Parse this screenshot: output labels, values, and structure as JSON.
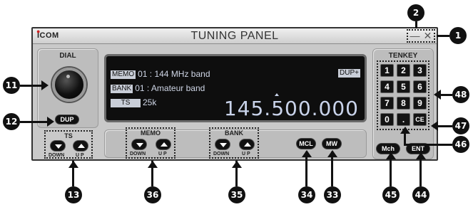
{
  "window": {
    "logo": "ICOM",
    "title": "TUNING PANEL",
    "minimize_glyph": "—",
    "close_glyph": "✕"
  },
  "dial": {
    "label": "DIAL",
    "dup_button": "DUP"
  },
  "ts_group": {
    "label": "TS",
    "down": "DOWN",
    "up": "U P"
  },
  "memo_group": {
    "label": "MEMO",
    "down": "DOWN",
    "up": "U P"
  },
  "bank_group": {
    "label": "BANK",
    "down": "DOWN",
    "up": "U P"
  },
  "buttons": {
    "mcl": "MCL",
    "mw": "MW",
    "mch": "Mch",
    "ent": "ENT"
  },
  "display": {
    "memo_tag": "MEMO",
    "memo_text": "01 : 144 MHz band",
    "bank_tag": "BANK",
    "bank_text": "01 : Amateur band",
    "ts_tag": "TS",
    "ts_text": "25k",
    "dup_indicator": "DUP+",
    "frequency": "145.500.000"
  },
  "tenkey": {
    "label": "TENKEY",
    "keys": [
      "1",
      "2",
      "3",
      "4",
      "5",
      "6",
      "7",
      "8",
      "9",
      "0",
      ".",
      "CE"
    ]
  },
  "callouts": {
    "c1": "1",
    "c2": "2",
    "c11": "11",
    "c12": "12",
    "c13": "13",
    "c33": "33",
    "c34": "34",
    "c35": "35",
    "c36": "36",
    "c44": "44",
    "c45": "45",
    "c46": "46",
    "c47": "47",
    "c48": "48"
  },
  "colors": {
    "panel": "#c9c9c9",
    "display_bg": "#0e0e0e",
    "lcd_text": "#cfd6e6",
    "button": "#111111",
    "callout": "#111111"
  }
}
